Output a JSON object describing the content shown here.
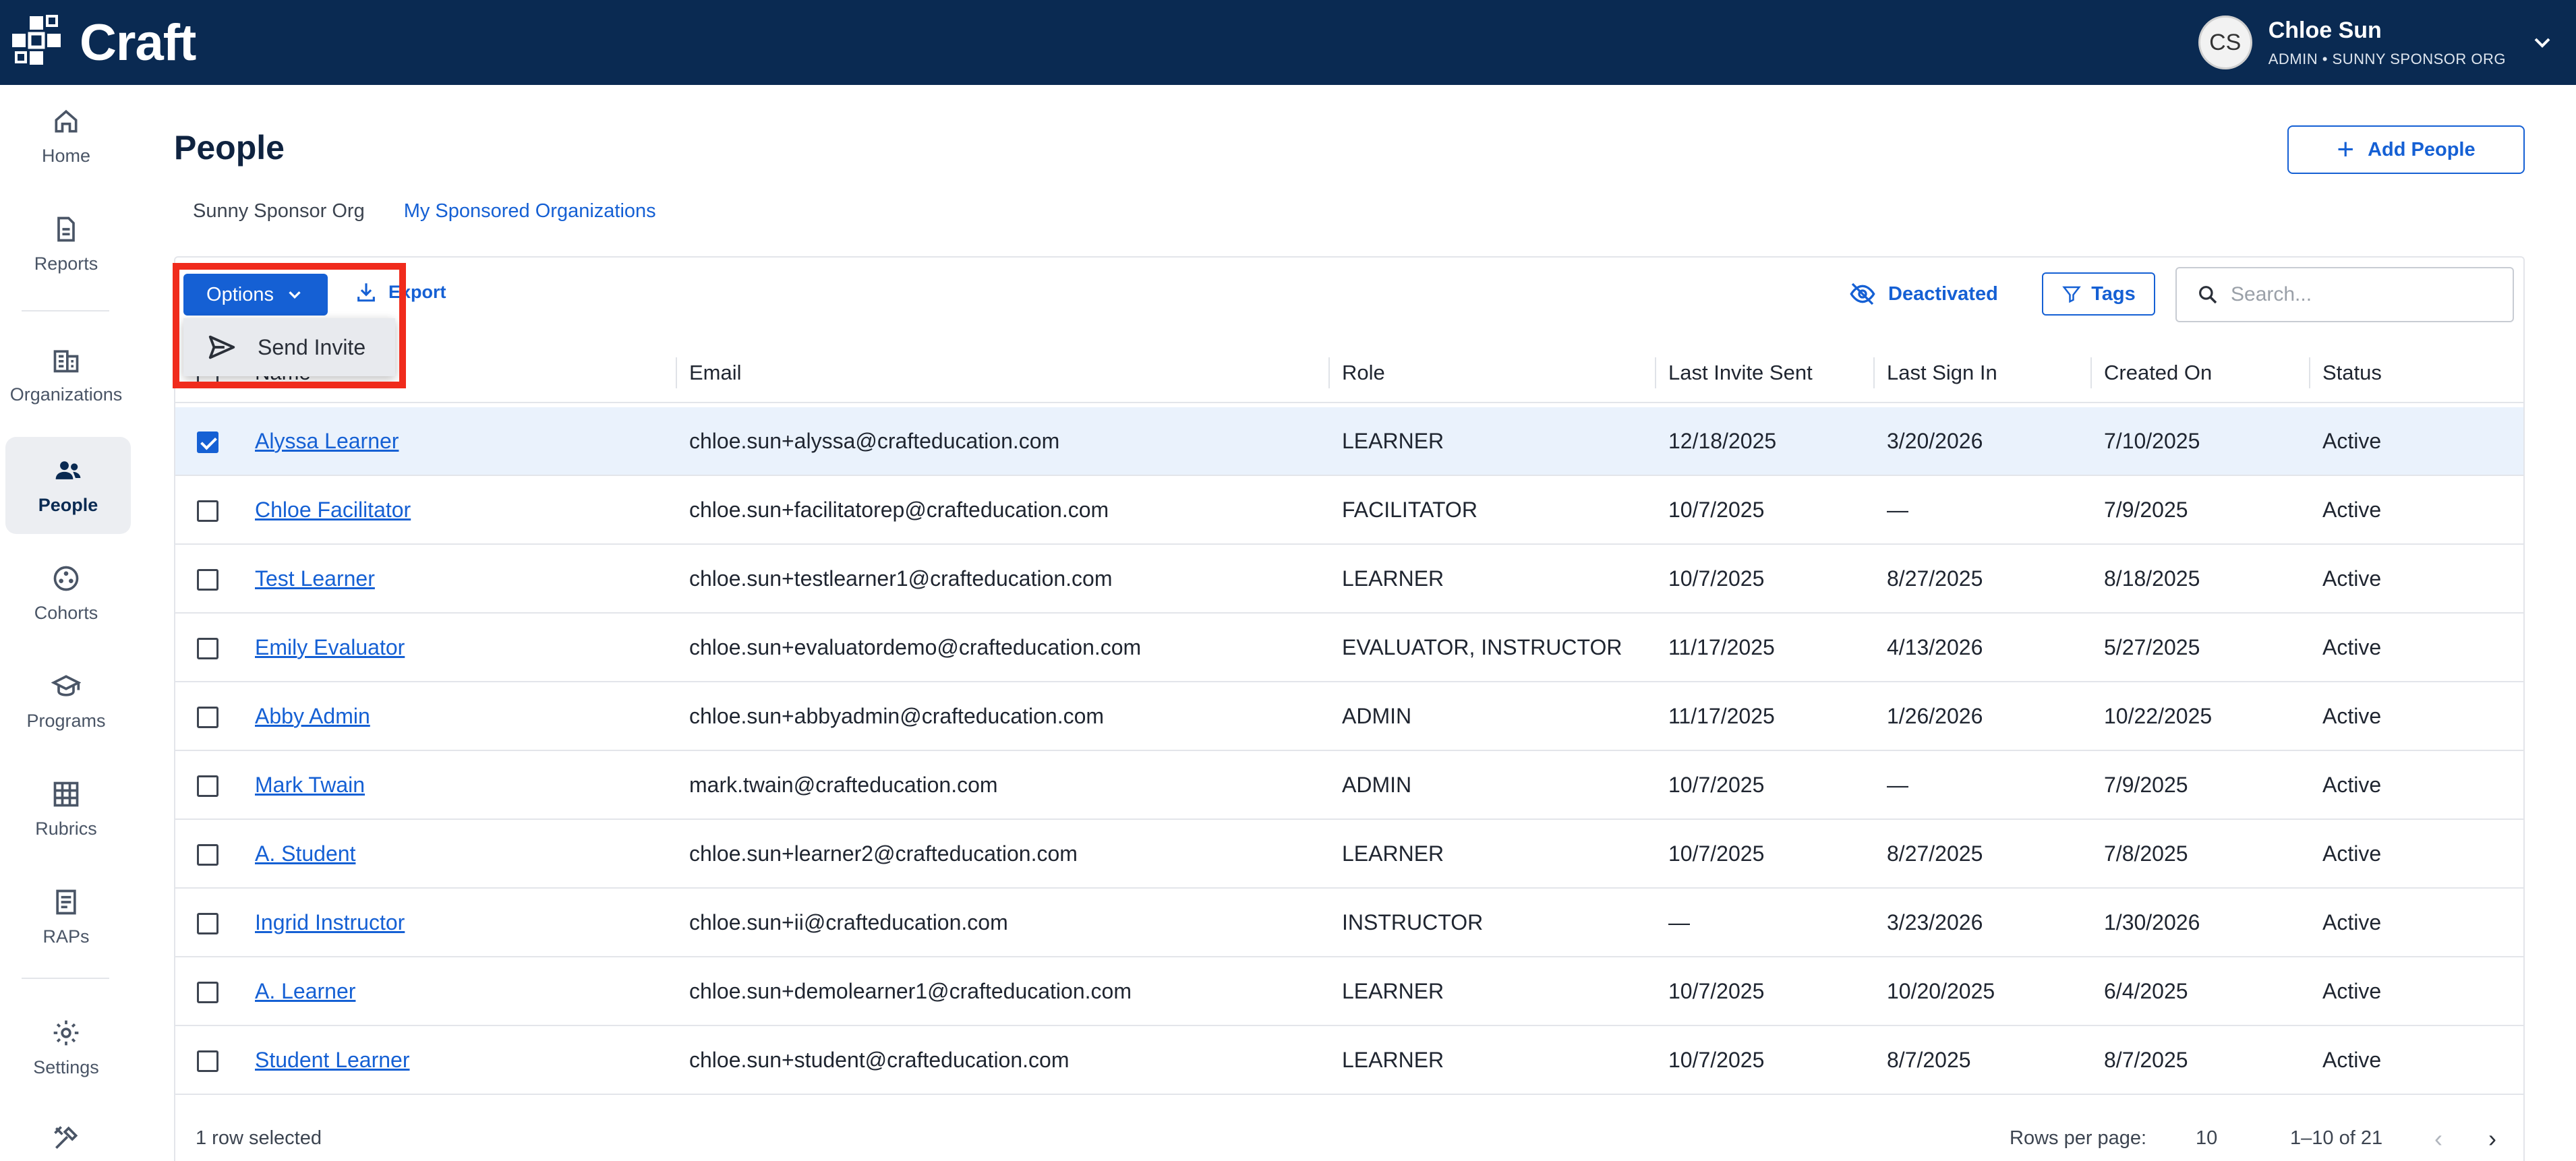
{
  "app": {
    "name": "Craft"
  },
  "user": {
    "initials": "CS",
    "name": "Chloe Sun",
    "role": "ADMIN • SUNNY SPONSOR ORG"
  },
  "sidebar": {
    "items": [
      {
        "label": "Home",
        "icon": "home-icon"
      },
      {
        "label": "Reports",
        "icon": "reports-icon"
      },
      {
        "label": "Organizations",
        "icon": "organizations-icon"
      },
      {
        "label": "People",
        "icon": "people-icon",
        "active": true
      },
      {
        "label": "Cohorts",
        "icon": "cohorts-icon"
      },
      {
        "label": "Programs",
        "icon": "programs-icon"
      },
      {
        "label": "Rubrics",
        "icon": "rubrics-icon"
      },
      {
        "label": "RAPs",
        "icon": "raps-icon"
      },
      {
        "label": "Settings",
        "icon": "settings-icon"
      }
    ]
  },
  "page": {
    "title": "People",
    "add_button": "Add People",
    "org_tabs": [
      "Sunny Sponsor Org",
      "My Sponsored Organizations"
    ]
  },
  "toolbar": {
    "options_label": "Options",
    "export_label": "Export",
    "deactivated_label": "Deactivated",
    "tags_label": "Tags",
    "search_placeholder": "Search..."
  },
  "menu": {
    "send_invite": "Send Invite"
  },
  "table": {
    "headers": {
      "name": "Name",
      "email": "Email",
      "role": "Role",
      "last_invite": "Last Invite Sent",
      "last_sign_in": "Last Sign In",
      "created_on": "Created On",
      "status": "Status"
    },
    "rows": [
      {
        "name": "Alyssa Learner",
        "email": "chloe.sun+alyssa@crafteducation.com",
        "role": "LEARNER",
        "last_invite": "12/18/2025",
        "last_sign_in": "3/20/2026",
        "created_on": "7/10/2025",
        "status": "Active",
        "selected": true
      },
      {
        "name": "Chloe Facilitator",
        "email": "chloe.sun+facilitatorep@crafteducation.com",
        "role": "FACILITATOR",
        "last_invite": "10/7/2025",
        "last_sign_in": "—",
        "created_on": "7/9/2025",
        "status": "Active"
      },
      {
        "name": "Test Learner",
        "email": "chloe.sun+testlearner1@crafteducation.com",
        "role": "LEARNER",
        "last_invite": "10/7/2025",
        "last_sign_in": "8/27/2025",
        "created_on": "8/18/2025",
        "status": "Active"
      },
      {
        "name": "Emily Evaluator",
        "email": "chloe.sun+evaluatordemo@crafteducation.com",
        "role": "EVALUATOR, INSTRUCTOR",
        "last_invite": "11/17/2025",
        "last_sign_in": "4/13/2026",
        "created_on": "5/27/2025",
        "status": "Active"
      },
      {
        "name": "Abby Admin",
        "email": "chloe.sun+abbyadmin@crafteducation.com",
        "role": "ADMIN",
        "last_invite": "11/17/2025",
        "last_sign_in": "1/26/2026",
        "created_on": "10/22/2025",
        "status": "Active"
      },
      {
        "name": "Mark Twain",
        "email": "mark.twain@crafteducation.com",
        "role": "ADMIN",
        "last_invite": "10/7/2025",
        "last_sign_in": "—",
        "created_on": "7/9/2025",
        "status": "Active"
      },
      {
        "name": "A. Student",
        "email": "chloe.sun+learner2@crafteducation.com",
        "role": "LEARNER",
        "last_invite": "10/7/2025",
        "last_sign_in": "8/27/2025",
        "created_on": "7/8/2025",
        "status": "Active"
      },
      {
        "name": "Ingrid Instructor",
        "email": "chloe.sun+ii@crafteducation.com",
        "role": "INSTRUCTOR",
        "last_invite": "—",
        "last_sign_in": "3/23/2026",
        "created_on": "1/30/2026",
        "status": "Active"
      },
      {
        "name": "A. Learner",
        "email": "chloe.sun+demolearner1@crafteducation.com",
        "role": "LEARNER",
        "last_invite": "10/7/2025",
        "last_sign_in": "10/20/2025",
        "created_on": "6/4/2025",
        "status": "Active"
      },
      {
        "name": "Student Learner",
        "email": "chloe.sun+student@crafteducation.com",
        "role": "LEARNER",
        "last_invite": "10/7/2025",
        "last_sign_in": "8/7/2025",
        "created_on": "8/7/2025",
        "status": "Active"
      }
    ]
  },
  "footer": {
    "selected_text": "1 row selected",
    "rows_per_page_label": "Rows per page:",
    "rows_per_page": "10",
    "range": "1–10 of 21"
  },
  "colors": {
    "header_bg": "#0a2a52",
    "accent": "#1560d4",
    "highlight": "#f02b1c",
    "selected_row": "#eaf2fc"
  }
}
